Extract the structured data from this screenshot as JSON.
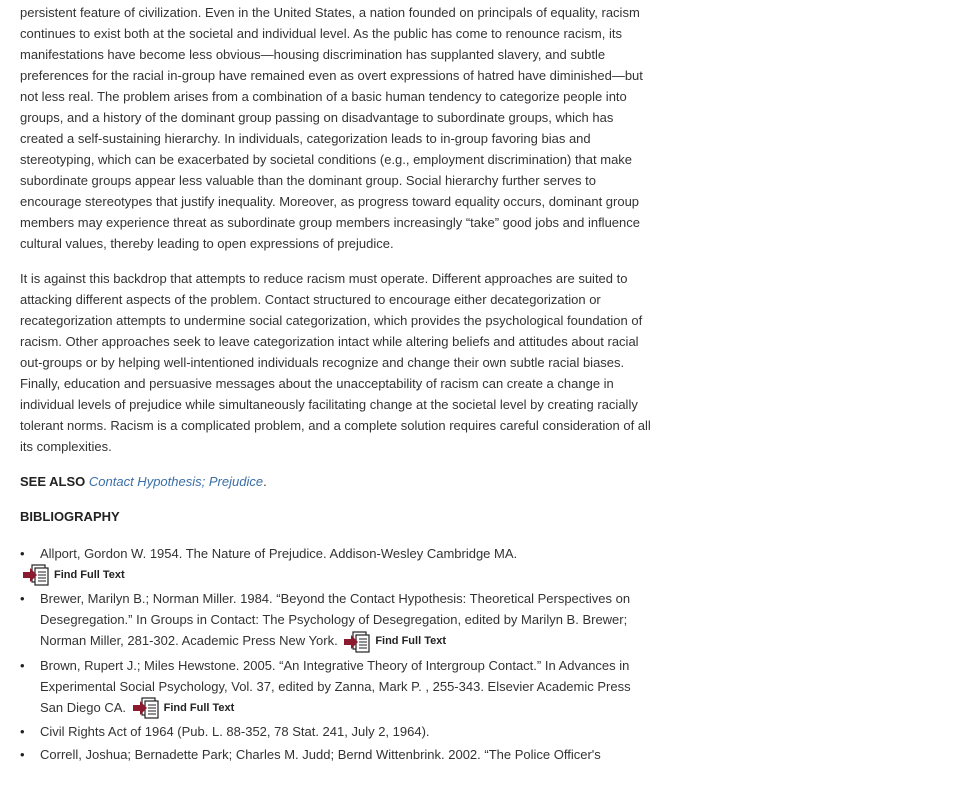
{
  "paragraphs": [
    "persistent feature of civilization. Even in the United States, a nation founded on principals of equality, racism continues to exist both at the societal and individual level. As the public has come to renounce racism, its manifestations have become less obvious—housing discrimination has supplanted slavery, and subtle preferences for the racial in-group have remained even as overt expressions of hatred have diminished—but not less real. The problem arises from a combination of a basic human tendency to categorize people into groups, and a history of the dominant group passing on disadvantage to subordinate groups, which has created a self-sustaining hierarchy. In individuals, categorization leads to in-group favoring bias and stereotyping, which can be exacerbated by societal conditions (e.g., employment discrimination) that make subordinate groups appear less valuable than the dominant group. Social hierarchy further serves to encourage stereotypes that justify inequality. Moreover, as progress toward equality occurs, dominant group members may experience threat as subordinate group members increasingly “take” good jobs and influence cultural values, thereby leading to open expressions of prejudice.",
    "It is against this backdrop that attempts to reduce racism must operate. Different approaches are suited to attacking different aspects of the problem. Contact structured to encourage either decategorization or recategorization attempts to undermine social categorization, which provides the psychological foundation of racism. Other approaches seek to leave categorization intact while altering beliefs and attitudes about racial out-groups or by helping well-intentioned individuals recognize and change their own subtle racial biases. Finally, education and persuasive messages about the unacceptability of racism can create a change in individual levels of prejudice while simultaneously facilitating change at the societal level by creating racially tolerant norms. Racism is a complicated problem, and a complete solution requires careful consideration of all its complexities."
  ],
  "see_also": {
    "label": "SEE ALSO",
    "link1": "Contact Hypothesis",
    "sep": "; ",
    "link2": "Prejudice",
    "end": "."
  },
  "bibliography_heading": "BIBLIOGRAPHY",
  "find_full_text_label": "Find Full Text",
  "bibliography": [
    "Allport, Gordon W. 1954. The Nature of Prejudice. Addison-Wesley Cambridge MA.",
    "Brewer, Marilyn B.; Norman Miller. 1984. “Beyond the Contact Hypothesis: Theoretical Perspectives on Desegregation.” In Groups in Contact: The Psychology of Desegregation, edited by Marilyn B. Brewer; Norman Miller, 281-302. Academic Press New York.",
    "Brown, Rupert J.; Miles Hewstone. 2005. “An Integrative Theory of Intergroup Contact.” In Advances in Experimental Social Psychology, Vol. 37, edited by Zanna, Mark P. , 255-343. Elsevier Academic Press San Diego CA.",
    "Civil Rights Act of 1964 (Pub. L. 88-352, 78 Stat. 241, July 2, 1964).",
    "Correll, Joshua; Bernadette Park; Charles M. Judd; Bernd Wittenbrink. 2002. “The Police Officer's"
  ],
  "colors": {
    "text": "#333333",
    "link": "#3a6fa7",
    "icon_arrow": "#8b1a2e"
  }
}
